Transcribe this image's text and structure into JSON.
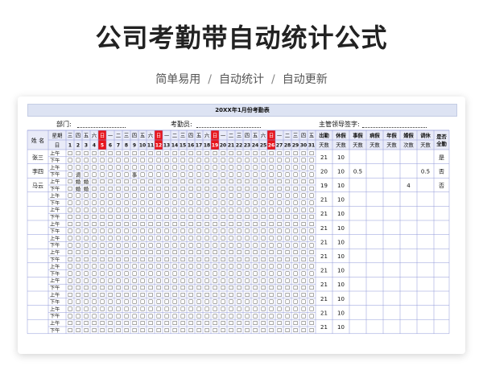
{
  "heading": "公司考勤带自动统计公式",
  "subtitle": [
    "简单易用",
    "自动统计",
    "自动更新"
  ],
  "subtitle_sep": "/",
  "sheet": {
    "title": "20XX年1月份考勤表",
    "dept_label": "部门:",
    "clerk_label": "考勤员:",
    "sign_label": "主管领导签字:",
    "name_header": "姓  名",
    "weekday_label": "星期",
    "day_label": "日",
    "weekdays": [
      "三",
      "四",
      "五",
      "六",
      "日",
      "一",
      "二",
      "三",
      "四",
      "五",
      "六",
      "日",
      "一",
      "二",
      "三",
      "四",
      "五",
      "六",
      "日",
      "一",
      "二",
      "三",
      "四",
      "五",
      "六",
      "日",
      "一",
      "二",
      "三",
      "四",
      "五"
    ],
    "days": [
      "1",
      "2",
      "3",
      "4",
      "5",
      "6",
      "7",
      "8",
      "9",
      "10",
      "11",
      "12",
      "13",
      "14",
      "15",
      "16",
      "17",
      "18",
      "19",
      "20",
      "21",
      "22",
      "23",
      "24",
      "25",
      "26",
      "27",
      "28",
      "29",
      "30",
      "31"
    ],
    "sundays": [
      "5",
      "12",
      "19",
      "26"
    ],
    "summary_headers": [
      "出勤",
      "休假",
      "事假",
      "病假",
      "年假",
      "婚假",
      "调休",
      "是否全勤"
    ],
    "summary_units": [
      "天数",
      "天数",
      "天数",
      "天数",
      "天数",
      "次数",
      "天数",
      ""
    ],
    "am_label": "上午",
    "pm_label": "下午",
    "checkbox": "☐",
    "employees": [
      {
        "name": "张三",
        "am_marks": {},
        "pm_marks": {},
        "summary": [
          "21",
          "10",
          "",
          "",
          "",
          "",
          "",
          "是"
        ]
      },
      {
        "name": "李四",
        "am_marks": {},
        "pm_marks": {
          "2": "调",
          "9": "事"
        },
        "summary": [
          "20",
          "10",
          "0.5",
          "",
          "",
          "",
          "0.5",
          "否"
        ]
      },
      {
        "name": "马云",
        "am_marks": {
          "2": "婚",
          "3": "婚"
        },
        "pm_marks": {
          "2": "婚",
          "3": "婚"
        },
        "summary": [
          "19",
          "10",
          "",
          "",
          "",
          "4",
          "",
          "否"
        ]
      },
      {
        "name": "",
        "am_marks": {},
        "pm_marks": {},
        "summary": [
          "21",
          "10",
          "",
          "",
          "",
          "",
          "",
          ""
        ]
      },
      {
        "name": "",
        "am_marks": {},
        "pm_marks": {},
        "summary": [
          "21",
          "10",
          "",
          "",
          "",
          "",
          "",
          ""
        ]
      },
      {
        "name": "",
        "am_marks": {},
        "pm_marks": {},
        "summary": [
          "21",
          "10",
          "",
          "",
          "",
          "",
          "",
          ""
        ]
      },
      {
        "name": "",
        "am_marks": {},
        "pm_marks": {},
        "summary": [
          "21",
          "10",
          "",
          "",
          "",
          "",
          "",
          ""
        ]
      },
      {
        "name": "",
        "am_marks": {},
        "pm_marks": {},
        "summary": [
          "21",
          "10",
          "",
          "",
          "",
          "",
          "",
          ""
        ]
      },
      {
        "name": "",
        "am_marks": {},
        "pm_marks": {},
        "summary": [
          "21",
          "10",
          "",
          "",
          "",
          "",
          "",
          ""
        ]
      },
      {
        "name": "",
        "am_marks": {},
        "pm_marks": {},
        "summary": [
          "21",
          "10",
          "",
          "",
          "",
          "",
          "",
          ""
        ]
      },
      {
        "name": "",
        "am_marks": {},
        "pm_marks": {},
        "summary": [
          "21",
          "10",
          "",
          "",
          "",
          "",
          "",
          ""
        ]
      },
      {
        "name": "",
        "am_marks": {},
        "pm_marks": {},
        "summary": [
          "21",
          "10",
          "",
          "",
          "",
          "",
          "",
          ""
        ]
      },
      {
        "name": "",
        "am_marks": {},
        "pm_marks": {},
        "summary": [
          "21",
          "10",
          "",
          "",
          "",
          "",
          "",
          ""
        ]
      }
    ]
  },
  "colors": {
    "grid": "#8f97d8",
    "header_bg": "#e9ebf8",
    "sunday_bg": "#e8141b",
    "text": "#111111"
  }
}
